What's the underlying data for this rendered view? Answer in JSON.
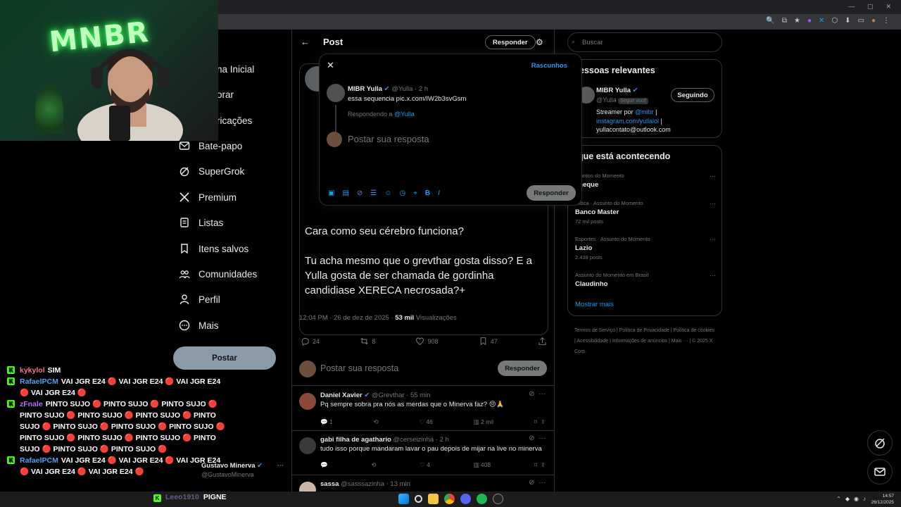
{
  "browser": {
    "window_controls": [
      "—",
      "▢",
      "✕"
    ],
    "toolbar_icons": [
      "🔍",
      "⧉",
      "★",
      "●",
      "✕",
      "⬡",
      "⬇",
      "▭",
      "●",
      "⋮"
    ]
  },
  "nav": {
    "items": [
      {
        "label": "na Inicial",
        "icon": "home-icon"
      },
      {
        "label": "orar",
        "icon": "search-icon"
      },
      {
        "label": "ricações",
        "icon": "bell-icon"
      },
      {
        "label": "Bate-papo",
        "icon": "mail-icon"
      },
      {
        "label": "SuperGrok",
        "icon": "grok-icon"
      },
      {
        "label": "Premium",
        "icon": "x-logo-icon"
      },
      {
        "label": "Listas",
        "icon": "list-icon"
      },
      {
        "label": "Itens salvos",
        "icon": "bookmark-icon"
      },
      {
        "label": "Comunidades",
        "icon": "people-icon"
      },
      {
        "label": "Perfil",
        "icon": "person-icon"
      },
      {
        "label": "Mais",
        "icon": "more-icon"
      }
    ],
    "post_button": "Postar"
  },
  "center": {
    "header": {
      "title": "Post",
      "reply_button": "Responder"
    },
    "tweet_text": [
      "Cara como seu cérebro funciona?",
      "Tu acha mesmo que o grevthar gosta disso? E a Yulla gosta de ser chamada de gordinha candidiase XERECA necrosada?+"
    ],
    "meta": {
      "time": "12:04 PM · 26 de dez de 2025 · ",
      "views": "53 mil",
      "views_label": " Visualizações"
    },
    "actions": {
      "replies": "24",
      "reposts": "8",
      "likes": "908",
      "bookmarks": "47"
    },
    "reply_placeholder": "Postar sua resposta",
    "reply_button": "Responder",
    "comments": [
      {
        "name": "Daniel Xavier",
        "handle": "@Grevthar · 55 min",
        "text": "Pq sempre sobra pra nós as merdas que o Minerva faz? 😔🙏",
        "replies": "1",
        "reposts": "",
        "likes": "46",
        "views": "2 mil"
      },
      {
        "name": "gabi filha de agathario",
        "handle": "@cerseizinha · 2 h",
        "text": "tudo isso porque mandaram lavar o pau depois de mijar na live no minerva",
        "replies": "",
        "reposts": "",
        "likes": "4",
        "views": "408"
      },
      {
        "name": "sassa",
        "handle": "@sasssazinha · 13 min",
        "text": "",
        "replies": "",
        "reposts": "",
        "likes": "",
        "views": ""
      }
    ],
    "other_name": "Gustavo Minerva",
    "other_handle": "@GustavoMinerva"
  },
  "modal": {
    "drafts": "Rascunhos",
    "quoted_name": "MIBR Yulla",
    "quoted_handle": "@Yulla · 2 h",
    "quoted_text": "essa sequencia pic.x.com/IW2b3svGsm",
    "replying_prefix": "Respondendo a ",
    "replying_to": "@Yulla",
    "placeholder": "Postar sua resposta",
    "reply_button": "Responder"
  },
  "right": {
    "search_placeholder": "Buscar",
    "relevant_title": "essoas relevantes",
    "relevant_user": {
      "name": "MIBR Yulla",
      "handle": "@Yulla",
      "follows_you": "Segue você",
      "follow_button": "Seguindo",
      "bio_1": "Streamer por ",
      "bio_mention": "@mibr",
      "bio_sep": " |",
      "bio_link": "instagram.com/yullalol",
      "bio_sep2": " |",
      "bio_email": "yullacontato@outlook.com"
    },
    "trends_title": " que está acontecendo",
    "trends": [
      {
        "category": "ssuntos do Momento",
        "name": "cheque",
        "posts": ""
      },
      {
        "category": "olítica · Assunto do Momento",
        "name": "Banco Master",
        "posts": "72 mil posts"
      },
      {
        "category": "Esportes · Assunto do Momento",
        "name": "Lazio",
        "posts": "2.438 posts"
      },
      {
        "category": "Assunto do Momento em Brasil",
        "name": "Claudinho",
        "posts": ""
      }
    ],
    "show_more": "Mostrar mais",
    "footer": "Termos de Serviço  |  Política de Privacidade  |  Política de cookies  |  Acessibilidade  |  Informações de anúncios  |  Mais ···  |  © 2025 X Corp."
  },
  "webcam": {
    "neon_text": "MNBR"
  },
  "chat": {
    "lines": [
      {
        "user": "kykylol",
        "color": "#ff6b9a",
        "msg": "SIM"
      },
      {
        "user": "RafaelPCM",
        "color": "#4aa3ff",
        "msg": "VAI JGR E24 🔴 VAI JGR E24 🔴 VAI JGR E24 🔴 VAI JGR E24 🔴"
      },
      {
        "user": "zFnale",
        "color": "#b46bff",
        "msg": "PINTO SUJO 🔴 PINTO SUJO 🔴 PINTO SUJO 🔴 PINTO SUJO 🔴 PINTO SUJO 🔴 PINTO SUJO 🔴 PINTO SUJO 🔴 PINTO SUJO 🔴 PINTO SUJO 🔴 PINTO SUJO 🔴 PINTO SUJO 🔴 PINTO SUJO 🔴 PINTO SUJO 🔴 PINTO SUJO 🔴 PINTO SUJO 🔴 PINTO SUJO 🔴"
      },
      {
        "user": "RafaelPCM",
        "color": "#4aa3ff",
        "msg": "VAI JGR E24 🔴 VAI JGR E24 🔴 VAI JGR E24 🔴 VAI JGR E24 🔴 VAI JGR E24 🔴"
      }
    ],
    "bottom_user": "Leeo1910",
    "bottom_user_color": "#6a5a8a",
    "bottom_msg": "PIGNE"
  },
  "taskbar": {
    "time": "14:57",
    "date": "26/12/2025"
  }
}
